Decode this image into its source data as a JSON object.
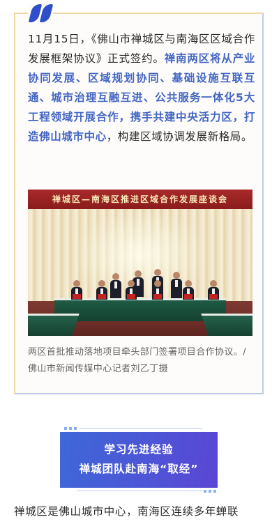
{
  "article": {
    "intro_plain_1": "11月15日，《佛山市禅城区与南海区区域合作发展框架协议》正式签约。",
    "intro_highlight": "禅南两区将从产业协同发展、区域规划协同、基础设施互联互通、城市治理互融互进、公共服务一体化5大工程领域开展合作，携手共建中央活力区，打造佛山城市中心",
    "intro_plain_2": "，构建区域协调发展新格局。",
    "photo_banner": "禅城区—南海区推进区域合作发展座谈会",
    "photo_caption": "两区首批推动落地项目牵头部门签署项目合作协议。/佛山市新闻传媒中心记者刘乙丁摄",
    "section_heading_line1": "学习先进经验",
    "section_heading_line2": "禅城团队赴南海“取经”",
    "body_start": "禅城区是佛山城市中心，南海区连续多年蝉联"
  },
  "colors": {
    "highlight": "#4466c4",
    "quote_mark": "#2f4ec9",
    "heading_bg_start": "#3e68d8",
    "heading_bg_end": "#5a46d4"
  },
  "icons": {
    "quote": "quote-mark-icon"
  }
}
